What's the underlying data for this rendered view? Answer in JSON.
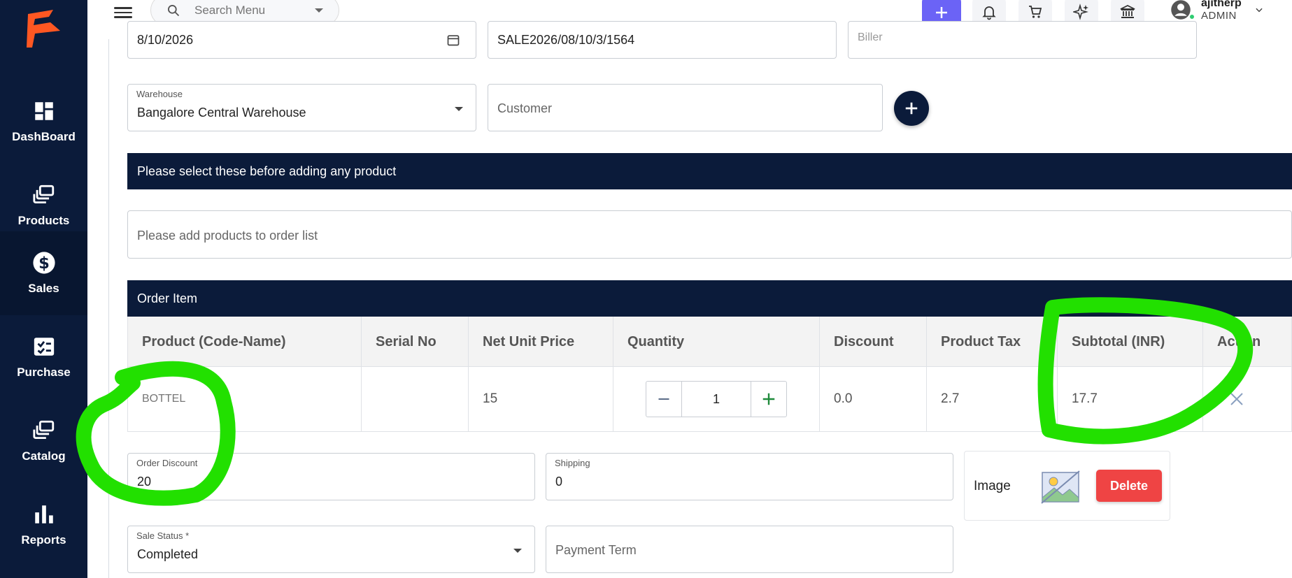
{
  "sidebar": {
    "items": [
      {
        "label": "DashBoard",
        "icon": "dashboard-icon"
      },
      {
        "label": "Products",
        "icon": "products-icon"
      },
      {
        "label": "Sales",
        "icon": "dollar-icon"
      },
      {
        "label": "Purchase",
        "icon": "purchase-icon"
      },
      {
        "label": "Catalog",
        "icon": "catalog-icon"
      },
      {
        "label": "Reports",
        "icon": "bar-chart-icon"
      }
    ]
  },
  "topbar": {
    "search_placeholder": "Search Menu",
    "user_name": "ajitherp",
    "user_role": "ADMIN",
    "accent": "#6b63f6"
  },
  "form": {
    "date_value": "8/10/2026",
    "reference_value": "SALE2026/08/10/3/1564",
    "biller_placeholder": "Biller",
    "warehouse_label": "Warehouse",
    "warehouse_value": "Bangalore Central Warehouse",
    "customer_placeholder": "Customer",
    "notice": "Please select these before adding any product",
    "product_search_placeholder": "Please add products to order list",
    "order_item_title": "Order Item",
    "order_discount_label": "Order Discount",
    "order_discount_value": "20",
    "shipping_label": "Shipping",
    "shipping_value": "0",
    "sale_status_label": "Sale Status *",
    "sale_status_value": "Completed",
    "payment_term_placeholder": "Payment Term",
    "image_label": "Image",
    "delete_label": "Delete"
  },
  "table": {
    "headers": [
      "Product (Code-Name)",
      "Serial No",
      "Net Unit Price",
      "Quantity",
      "Discount",
      "Product Tax",
      "Subtotal (INR)",
      "Action"
    ],
    "rows": [
      {
        "product": "BOTTEL",
        "serial": "",
        "net_unit_price": "15",
        "quantity": "1",
        "discount": "0.0",
        "product_tax": "2.7",
        "subtotal": "17.7"
      }
    ]
  },
  "colors": {
    "navy": "#0b1b3a",
    "delete": "#ef4444",
    "highlight": "#22e000"
  }
}
